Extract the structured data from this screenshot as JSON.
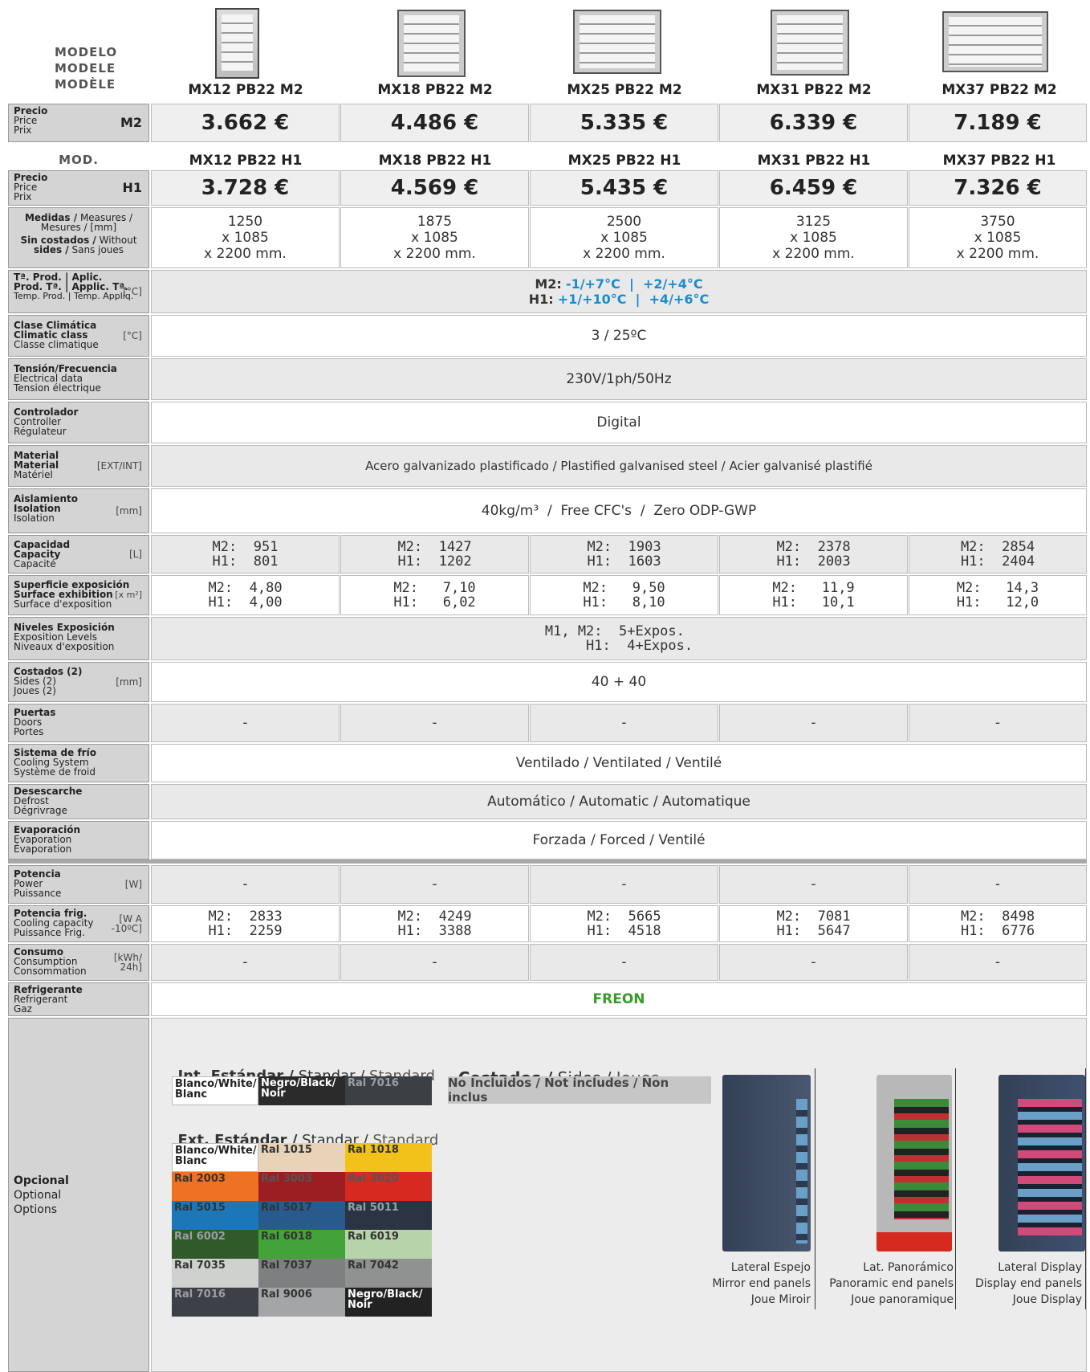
{
  "header": {
    "model_labels": [
      "MODELO",
      "MODELE",
      "MODÈLE"
    ],
    "mod_label": "MOD.",
    "models_m2": [
      "MX12 PB22 M2",
      "MX18 PB22 M2",
      "MX25 PB22 M2",
      "MX31 PB22 M2",
      "MX37 PB22 M2"
    ],
    "models_h1": [
      "MX12 PB22 H1",
      "MX18 PB22 H1",
      "MX25 PB22 H1",
      "MX31 PB22 H1",
      "MX37 PB22 H1"
    ]
  },
  "price_label": {
    "l1": "Precio",
    "l2": "Price",
    "l3": "Prix"
  },
  "m2": {
    "tag": "M2",
    "prices": [
      "3.662 €",
      "4.486 €",
      "5.335 €",
      "6.339 €",
      "7.189 €"
    ]
  },
  "h1": {
    "tag": "H1",
    "prices": [
      "3.728 €",
      "4.569 €",
      "5.435 €",
      "6.459 €",
      "7.326 €"
    ]
  },
  "measures": {
    "label": {
      "l1a": "Medidas /",
      "l1b": " Measures /",
      "l2": "Mesures / [mm]",
      "l3a": "Sin costados /",
      "l3b": " Without",
      "l4a": "sides /",
      "l4b": " Sans joues"
    },
    "values": [
      "1250\nx 1085\nx 2200 mm.",
      "1875\nx 1085\nx 2200 mm.",
      "2500\nx 1085\nx 2200 mm.",
      "3125\nx 1085\nx 2200 mm.",
      "3750\nx 1085\nx 2200 mm."
    ]
  },
  "temp": {
    "label": {
      "l1": "Tª. Prod. | Aplic.",
      "l2": "Prod. Tª. | Applic. Tª.",
      "unit": "[°C]",
      "l3": "Temp. Prod. | Temp. Appliq."
    },
    "m2_tag": "M2:",
    "m2_val": "-1/+7°C  |  +2/+4°C",
    "h1_tag": "H1:",
    "h1_val": "+1/+10°C  |  +4/+6°C"
  },
  "climatic": {
    "label": {
      "l1": "Clase Climática",
      "l2": "Climatic class",
      "l3": "Classe climatique",
      "unit": "[°C]"
    },
    "value": "3 / 25ºC"
  },
  "electrical": {
    "label": {
      "l1": "Tensión/Frecuencia",
      "l2": "Electrical data",
      "l3": "Tension électrique"
    },
    "value": "230V/1ph/50Hz"
  },
  "controller": {
    "label": {
      "l1": "Controlador",
      "l2": "Controller",
      "l3": "Régulateur"
    },
    "value": "Digital"
  },
  "material": {
    "label": {
      "l1": "Material",
      "l2": "Material",
      "l3": "Matériel",
      "unit": "[EXT/INT]"
    },
    "value": "Acero galvanizado plastificado / Plastified galvanised steel / Acier galvanisé plastifié"
  },
  "insulation": {
    "label": {
      "l1": "Aislamiento",
      "l2": "Isolation",
      "l3": "Isolation",
      "unit": "[mm]"
    },
    "value": "40kg/m³  /  Free CFC's  /  Zero ODP-GWP"
  },
  "capacity": {
    "label": {
      "l1": "Capacidad",
      "l2": "Capacity",
      "l3": "Capacité",
      "unit": "[L]"
    },
    "values": [
      "M2:  951\nH1:  801",
      "M2:  1427\nH1:  1202",
      "M2:  1903\nH1:  1603",
      "M2:  2378\nH1:  2003",
      "M2:  2854\nH1:  2404"
    ]
  },
  "surface": {
    "label": {
      "l1": "Superficie exposición",
      "l2": "Surface exhibition",
      "l3": "Surface d'exposition",
      "unit": "[x m²]"
    },
    "values": [
      "M2:  4,80\nH1:  4,00",
      "M2:   7,10\nH1:   6,02",
      "M2:   9,50\nH1:   8,10",
      "M2:   11,9\nH1:   10,1",
      "M2:   14,3\nH1:   12,0"
    ]
  },
  "levels": {
    "label": {
      "l1": "Niveles Exposición",
      "l2": "Exposition Levels",
      "l3": "Niveaux d'exposition"
    },
    "value": "M1, M2:  5+Expos.\n     H1:  4+Expos."
  },
  "sides": {
    "label": {
      "l1": "Costados (2)",
      "l2": "Sides (2)",
      "l3": "Joues (2)",
      "unit": "[mm]"
    },
    "value": "40 + 40"
  },
  "doors": {
    "label": {
      "l1": "Puertas",
      "l2": "Doors",
      "l3": "Portes"
    },
    "values": [
      "-",
      "-",
      "-",
      "-",
      "-"
    ]
  },
  "cooling": {
    "label": {
      "l1": "Sistema de frío",
      "l2": "Cooling System",
      "l3": "Système de froid"
    },
    "value": "Ventilado / Ventilated / Ventilé"
  },
  "defrost": {
    "label": {
      "l1": "Desescarche",
      "l2": "Defrost",
      "l3": "Dégrivrage"
    },
    "value": "Automático / Automatic / Automatique"
  },
  "evaporation": {
    "label": {
      "l1": "Evaporación",
      "l2": "Evaporation",
      "l3": "Évaporation"
    },
    "value": "Forzada / Forced / Ventilé"
  },
  "power": {
    "label": {
      "l1": "Potencia",
      "l2": "Power",
      "l3": "Puissance",
      "unit": "[W]"
    },
    "values": [
      "-",
      "-",
      "-",
      "-",
      "-"
    ]
  },
  "cooling_capacity": {
    "label": {
      "l1": "Potencia frig.",
      "l2": "Cooling capacity",
      "l3": "Puissance Frig.",
      "unit": "[W A\n-10ºC]"
    },
    "values": [
      "M2:  2833\nH1:  2259",
      "M2:  4249\nH1:  3388",
      "M2:  5665\nH1:  4518",
      "M2:  7081\nH1:  5647",
      "M2:  8498\nH1:  6776"
    ]
  },
  "consumption": {
    "label": {
      "l1": "Consumo",
      "l2": "Consumption",
      "l3": "Consommation",
      "unit": "[kWh/\n24h]"
    },
    "values": [
      "-",
      "-",
      "-",
      "-",
      "-"
    ]
  },
  "refrigerant": {
    "label": {
      "l1": "Refrigerante",
      "l2": "Refrigerant",
      "l3": "Gaz"
    },
    "value": "FREON"
  },
  "options": {
    "label": {
      "l1": "Opcional",
      "l2": "Optional",
      "l3": "Options"
    },
    "int_title": {
      "a": "Int. Estándar /",
      "b": " Standar /",
      "c": " Standard"
    },
    "int_swatches": [
      {
        "t": "Blanco/White/\nBlanc",
        "bg": "#ffffff",
        "fg": "#222"
      },
      {
        "t": "Negro/Black/\nNoir",
        "bg": "#2b2b2b",
        "fg": "#ffffff"
      },
      {
        "t": "Ral 7016",
        "bg": "#3c3f44",
        "fg": "#9aa0a6"
      }
    ],
    "ext_title": {
      "a": "Ext. Estándar /",
      "b": " Standar /",
      "c": " Standard"
    },
    "ext_swatches": [
      {
        "t": "Blanco/White/\nBlanc",
        "bg": "#ffffff",
        "fg": "#222"
      },
      {
        "t": "Ral 1015",
        "bg": "#e8d3b8",
        "fg": "#333"
      },
      {
        "t": "Ral 1018",
        "bg": "#f2c21b",
        "fg": "#333"
      },
      {
        "t": "Ral 2003",
        "bg": "#ef7123",
        "fg": "#333"
      },
      {
        "t": "Ral 3003",
        "bg": "#9b1f22",
        "fg": "#555"
      },
      {
        "t": "Ral 3020",
        "bg": "#d62a20",
        "fg": "#555"
      },
      {
        "t": "Ral 5015",
        "bg": "#1c77b8",
        "fg": "#333"
      },
      {
        "t": "Ral 5017",
        "bg": "#295a8e",
        "fg": "#333"
      },
      {
        "t": "Ral 5011",
        "bg": "#2c3342",
        "fg": "#9aa0a6"
      },
      {
        "t": "Ral 6002",
        "bg": "#305a2a",
        "fg": "#9aa0a6"
      },
      {
        "t": "Ral 6018",
        "bg": "#43a23a",
        "fg": "#333"
      },
      {
        "t": "Ral 6019",
        "bg": "#b7d3a9",
        "fg": "#333"
      },
      {
        "t": "Ral 7035",
        "bg": "#cfd1cf",
        "fg": "#333"
      },
      {
        "t": "Ral 7037",
        "bg": "#7d7f81",
        "fg": "#333"
      },
      {
        "t": "Ral 7042",
        "bg": "#8f9290",
        "fg": "#333"
      },
      {
        "t": "Ral 7016",
        "bg": "#3c4148",
        "fg": "#9aa0a6"
      },
      {
        "t": "Ral 9006",
        "bg": "#a3a5a6",
        "fg": "#333"
      },
      {
        "t": "Negro/Black/\nNoir",
        "bg": "#222222",
        "fg": "#ffffff"
      }
    ],
    "sides_title": {
      "a": "Costados /",
      "b": " Sides /",
      "c": " Joues"
    },
    "sides_box": "No Incluidos / Not includes / Non inclus",
    "panels": [
      {
        "l1": "Lateral Espejo",
        "l2": "Mirror end panels",
        "l3": "Joue Miroir"
      },
      {
        "l1": "Lat. Panorámico",
        "l2": "Panoramic end panels",
        "l3": "Joue panoramique"
      },
      {
        "l1": "Lateral Display",
        "l2": "Display end panels",
        "l3": "Joue Display"
      }
    ]
  }
}
